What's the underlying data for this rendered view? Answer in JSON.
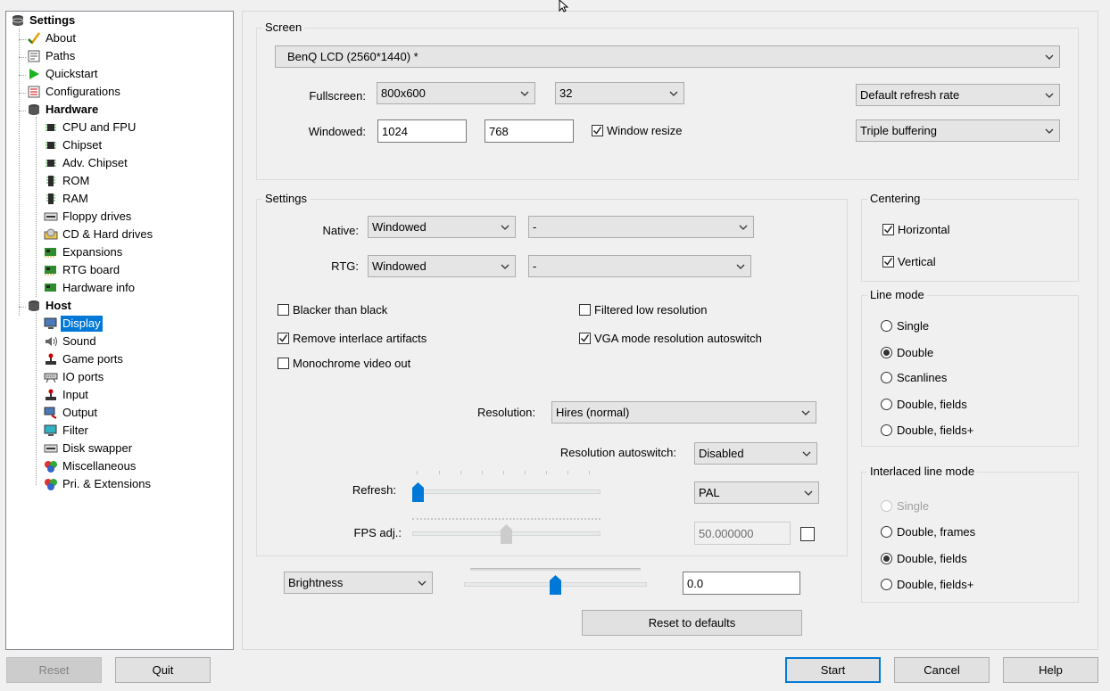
{
  "tree": {
    "root": "Settings",
    "items": [
      {
        "label": "About"
      },
      {
        "label": "Paths"
      },
      {
        "label": "Quickstart"
      },
      {
        "label": "Configurations"
      },
      {
        "label": "Hardware"
      },
      {
        "label": "CPU and FPU"
      },
      {
        "label": "Chipset"
      },
      {
        "label": "Adv. Chipset"
      },
      {
        "label": "ROM"
      },
      {
        "label": "RAM"
      },
      {
        "label": "Floppy drives"
      },
      {
        "label": "CD & Hard drives"
      },
      {
        "label": "Expansions"
      },
      {
        "label": "RTG board"
      },
      {
        "label": "Hardware info"
      },
      {
        "label": "Host"
      },
      {
        "label": "Display"
      },
      {
        "label": "Sound"
      },
      {
        "label": "Game ports"
      },
      {
        "label": "IO ports"
      },
      {
        "label": "Input"
      },
      {
        "label": "Output"
      },
      {
        "label": "Filter"
      },
      {
        "label": "Disk swapper"
      },
      {
        "label": "Miscellaneous"
      },
      {
        "label": "Pri. & Extensions"
      }
    ]
  },
  "screen": {
    "title": "Screen",
    "monitor": "BenQ LCD (2560*1440) *",
    "fullscreen_label": "Fullscreen:",
    "fullscreen_res": "800x600",
    "fullscreen_depth": "32",
    "windowed_label": "Windowed:",
    "windowed_width": "1024",
    "windowed_height": "768",
    "window_resize": "Window resize",
    "refresh_rate": "Default refresh rate",
    "buffering": "Triple buffering"
  },
  "settings": {
    "title": "Settings",
    "native_label": "Native:",
    "native_mode": "Windowed",
    "native_extra": "-",
    "rtg_label": "RTG:",
    "rtg_mode": "Windowed",
    "rtg_extra": "-",
    "blacker": "Blacker than black",
    "remove_interlace": "Remove interlace artifacts",
    "monochrome": "Monochrome video out",
    "filtered_low": "Filtered low resolution",
    "vga_autoswitch": "VGA mode resolution autoswitch",
    "resolution_label": "Resolution:",
    "resolution": "Hires (normal)",
    "autoswitch_label": "Resolution autoswitch:",
    "autoswitch": "Disabled",
    "refresh_label": "Refresh:",
    "refresh_mode": "PAL",
    "fps_label": "FPS adj.:",
    "fps_value": "50.000000"
  },
  "centering": {
    "title": "Centering",
    "horizontal": "Horizontal",
    "vertical": "Vertical"
  },
  "line_mode": {
    "title": "Line mode",
    "options": [
      "Single",
      "Double",
      "Scanlines",
      "Double, fields",
      "Double, fields+"
    ],
    "selected": "Double"
  },
  "interlaced_mode": {
    "title": "Interlaced line mode",
    "options": [
      "Single",
      "Double, frames",
      "Double, fields",
      "Double, fields+"
    ],
    "selected": "Double, fields"
  },
  "adjust": {
    "kind": "Brightness",
    "value": "0.0",
    "level": 0.5
  },
  "buttons": {
    "reset_defaults": "Reset to defaults",
    "reset": "Reset",
    "quit": "Quit",
    "start": "Start",
    "cancel": "Cancel",
    "help": "Help"
  }
}
